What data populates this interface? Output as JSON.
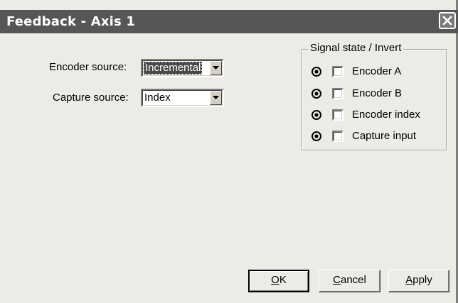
{
  "window": {
    "title": "Feedback - Axis 1"
  },
  "encoder_source": {
    "label": "Encoder source:",
    "value": "Incremental"
  },
  "capture_source": {
    "label": "Capture source:",
    "value": "Index"
  },
  "signal_group": {
    "title": "Signal state / Invert",
    "rows": [
      {
        "label": "Encoder A",
        "state": "on",
        "invert": false
      },
      {
        "label": "Encoder B",
        "state": "on",
        "invert": false
      },
      {
        "label": "Encoder index",
        "state": "on",
        "invert": false
      },
      {
        "label": "Capture input",
        "state": "on",
        "invert": false
      }
    ]
  },
  "buttons": {
    "ok": {
      "accel": "O",
      "rest": "K"
    },
    "cancel": {
      "accel": "C",
      "rest": "ancel"
    },
    "apply": {
      "accel": "A",
      "rest": "pply"
    }
  },
  "icons": {
    "close": "close-icon",
    "dropdown": "chevron-down-icon",
    "radio": "radio-selected-icon"
  }
}
